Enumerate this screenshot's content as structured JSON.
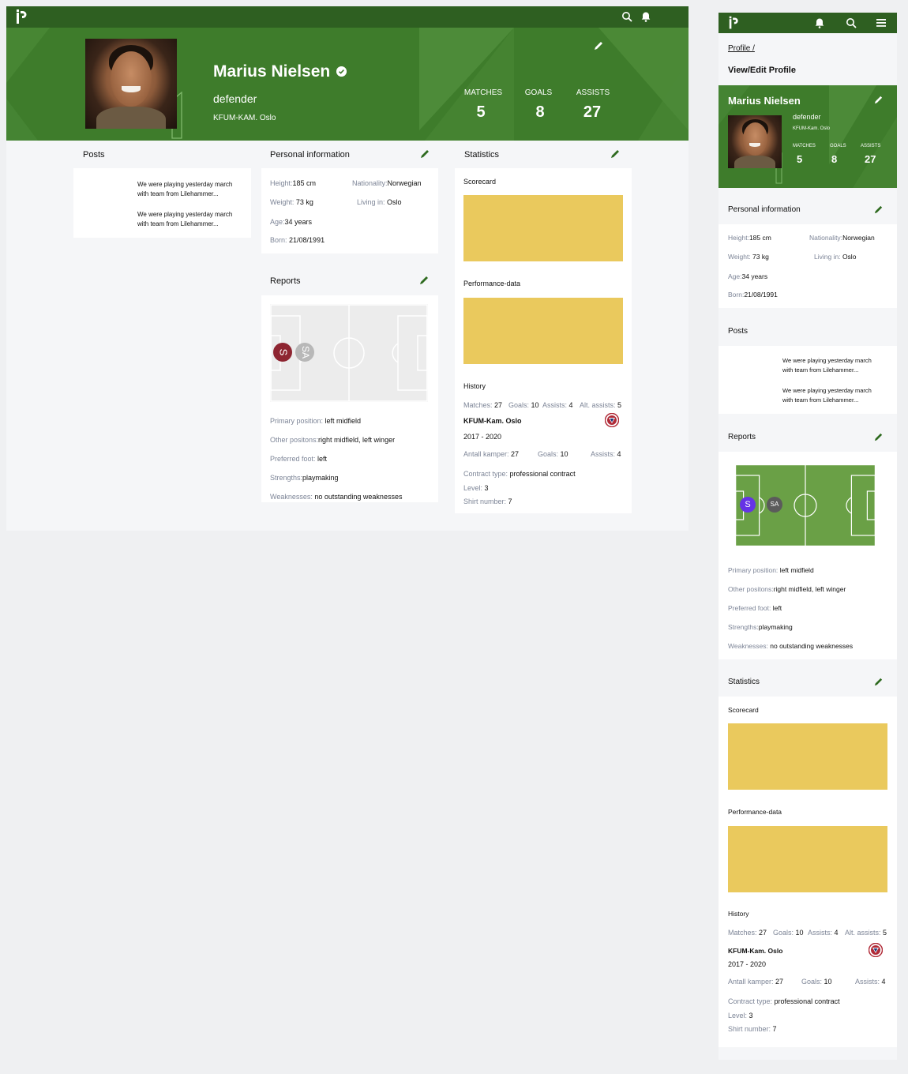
{
  "player": {
    "name": "Marius Nielsen",
    "role": "defender",
    "club_upper": "KFUM-KAM. Oslo",
    "club_small": "KFUM-Kam. Oslo"
  },
  "stats": {
    "matches_label": "MATCHES",
    "goals_label": "GOALS",
    "assists_label": "ASSISTS",
    "matches": "5",
    "goals": "8",
    "assists": "27"
  },
  "breadcrumb": {
    "profile": "Profile /",
    "page_title": "View/Edit Profile"
  },
  "posts": {
    "title": "Posts",
    "items": [
      {
        "line1": "We were playing yesterday march",
        "line2": "with team from Lilehammer..."
      },
      {
        "line1": "We were playing yesterday march",
        "line2": "with team from Lilehammer..."
      }
    ]
  },
  "personal": {
    "title": "Personal information",
    "height_label": "Height:",
    "height": "185 cm",
    "nationality_label": "Nationality:",
    "nationality": "Norwegian",
    "weight_label": "Weight:",
    "weight": "73 kg",
    "living_label": "Living in:",
    "living": "Oslo",
    "age_label": "Age:",
    "age": "34 years",
    "born_label": "Born:",
    "born": "21/08/1991"
  },
  "reports": {
    "title": "Reports",
    "marker_s": "S",
    "marker_sa": "SA",
    "primary_label": "Primary position:",
    "primary": "left midfield",
    "other_label": "Other positons:",
    "other": "right midfield, left winger",
    "foot_label": "Preferred foot:",
    "foot": "left",
    "strengths_label": "Strengths:",
    "strengths": "playmaking",
    "weak_label": "Weaknesses:",
    "weak": "no outstanding weaknesses"
  },
  "statistics": {
    "title": "Statistics",
    "scorecard": "Scorecard",
    "performance": "Performance-data",
    "history": "History",
    "h_matches_label": "Matches:",
    "h_matches": "27",
    "h_goals_label": "Goals:",
    "h_goals": "10",
    "h_assists_label": "Assists:",
    "h_assists": "4",
    "h_alt_label": "Alt. assists:",
    "h_alt": "5",
    "club": "KFUM-Kam. Oslo",
    "period": "2017 - 2020",
    "antall_label": "Antall kamper:",
    "antall": "27",
    "c_goals_label": "Goals:",
    "c_goals": "10",
    "c_assists_label": "Assists:",
    "c_assists": "4",
    "contract_label": "Contract type:",
    "contract": "professional contract",
    "level_label": "Level:",
    "level": "3",
    "shirt_label": "Shirt number:",
    "shirt": "7"
  },
  "colors": {
    "topbar": "#2e5f21",
    "hero": "#3e7c2b",
    "placeholder": "#eac95d",
    "pitch_green": "#6aa046",
    "marker_dark_red": "#8e2531",
    "marker_purple": "#6533e6"
  }
}
